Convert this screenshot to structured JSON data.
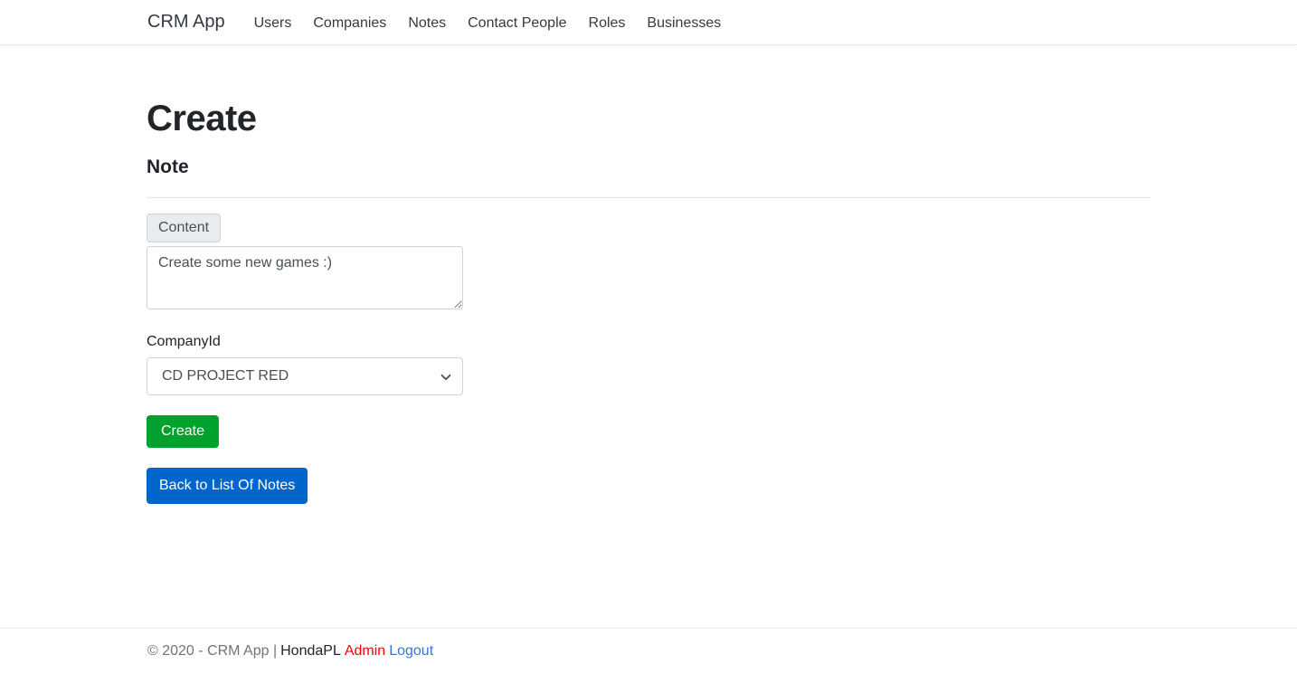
{
  "navbar": {
    "brand": "CRM App",
    "links": [
      {
        "label": "Users"
      },
      {
        "label": "Companies"
      },
      {
        "label": "Notes"
      },
      {
        "label": "Contact People"
      },
      {
        "label": "Roles"
      },
      {
        "label": "Businesses"
      }
    ]
  },
  "main": {
    "title": "Create",
    "subtitle": "Note",
    "form": {
      "content_label": "Content",
      "content_value": "Create some new games :)",
      "content_placeholder": "",
      "company_label": "CompanyId",
      "company_selected": "CD PROJECT RED",
      "company_options": [
        "CD PROJECT RED"
      ],
      "submit_label": "Create",
      "back_label": "Back to List Of Notes"
    }
  },
  "footer": {
    "copyright": "© 2020 - CRM App |",
    "user": "HondaPL",
    "role": "Admin",
    "logout": "Logout"
  },
  "icons": {
    "chevron_down": "chevron-down-icon"
  },
  "colors": {
    "create_button": "#00a22e",
    "back_button": "#0066cc",
    "role_text": "#ff0000",
    "logout_link": "#3377dd",
    "input_group_bg": "#e9ecef"
  }
}
